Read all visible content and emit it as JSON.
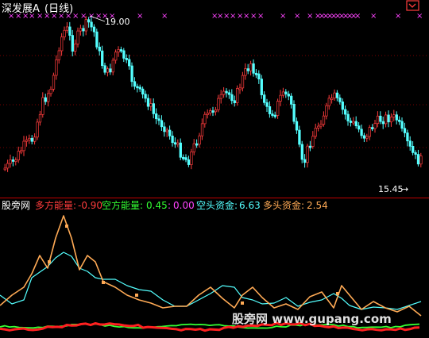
{
  "header": {
    "title": "深发展A",
    "period": "(日线)",
    "corner_icon": "expand-icon"
  },
  "price_panel": {
    "high_label": "19.00",
    "low_label": "15.45",
    "low_arrow": "→",
    "marker_glyph": "×",
    "candle_up_color": "#ff3c3c",
    "candle_down_color": "#54ffff",
    "marker_color": "#ff44ff",
    "separator_color": "#c00000"
  },
  "indicator_panel": {
    "name": "股旁网",
    "items": [
      {
        "label": "多方能量:",
        "value": "-0.90",
        "color": "#ff3c3c"
      },
      {
        "label": "空方能量:",
        "value": "0.45",
        "color": "#33ff33"
      },
      {
        "label": ":",
        "value": "0.00",
        "color": "#ff44ff"
      },
      {
        "label": "空头资金:",
        "value": "6.63",
        "color": "#54ffff"
      },
      {
        "label": "多头资金:",
        "value": "2.54",
        "color": "#ffaa55"
      }
    ],
    "line_colors": {
      "long_fund": "#ffaa55",
      "short_fund": "#54ffff",
      "long_energy": "#ff2020",
      "short_energy": "#33ff33"
    }
  },
  "watermark": {
    "text": "股旁网 www.gupang.com"
  }
}
